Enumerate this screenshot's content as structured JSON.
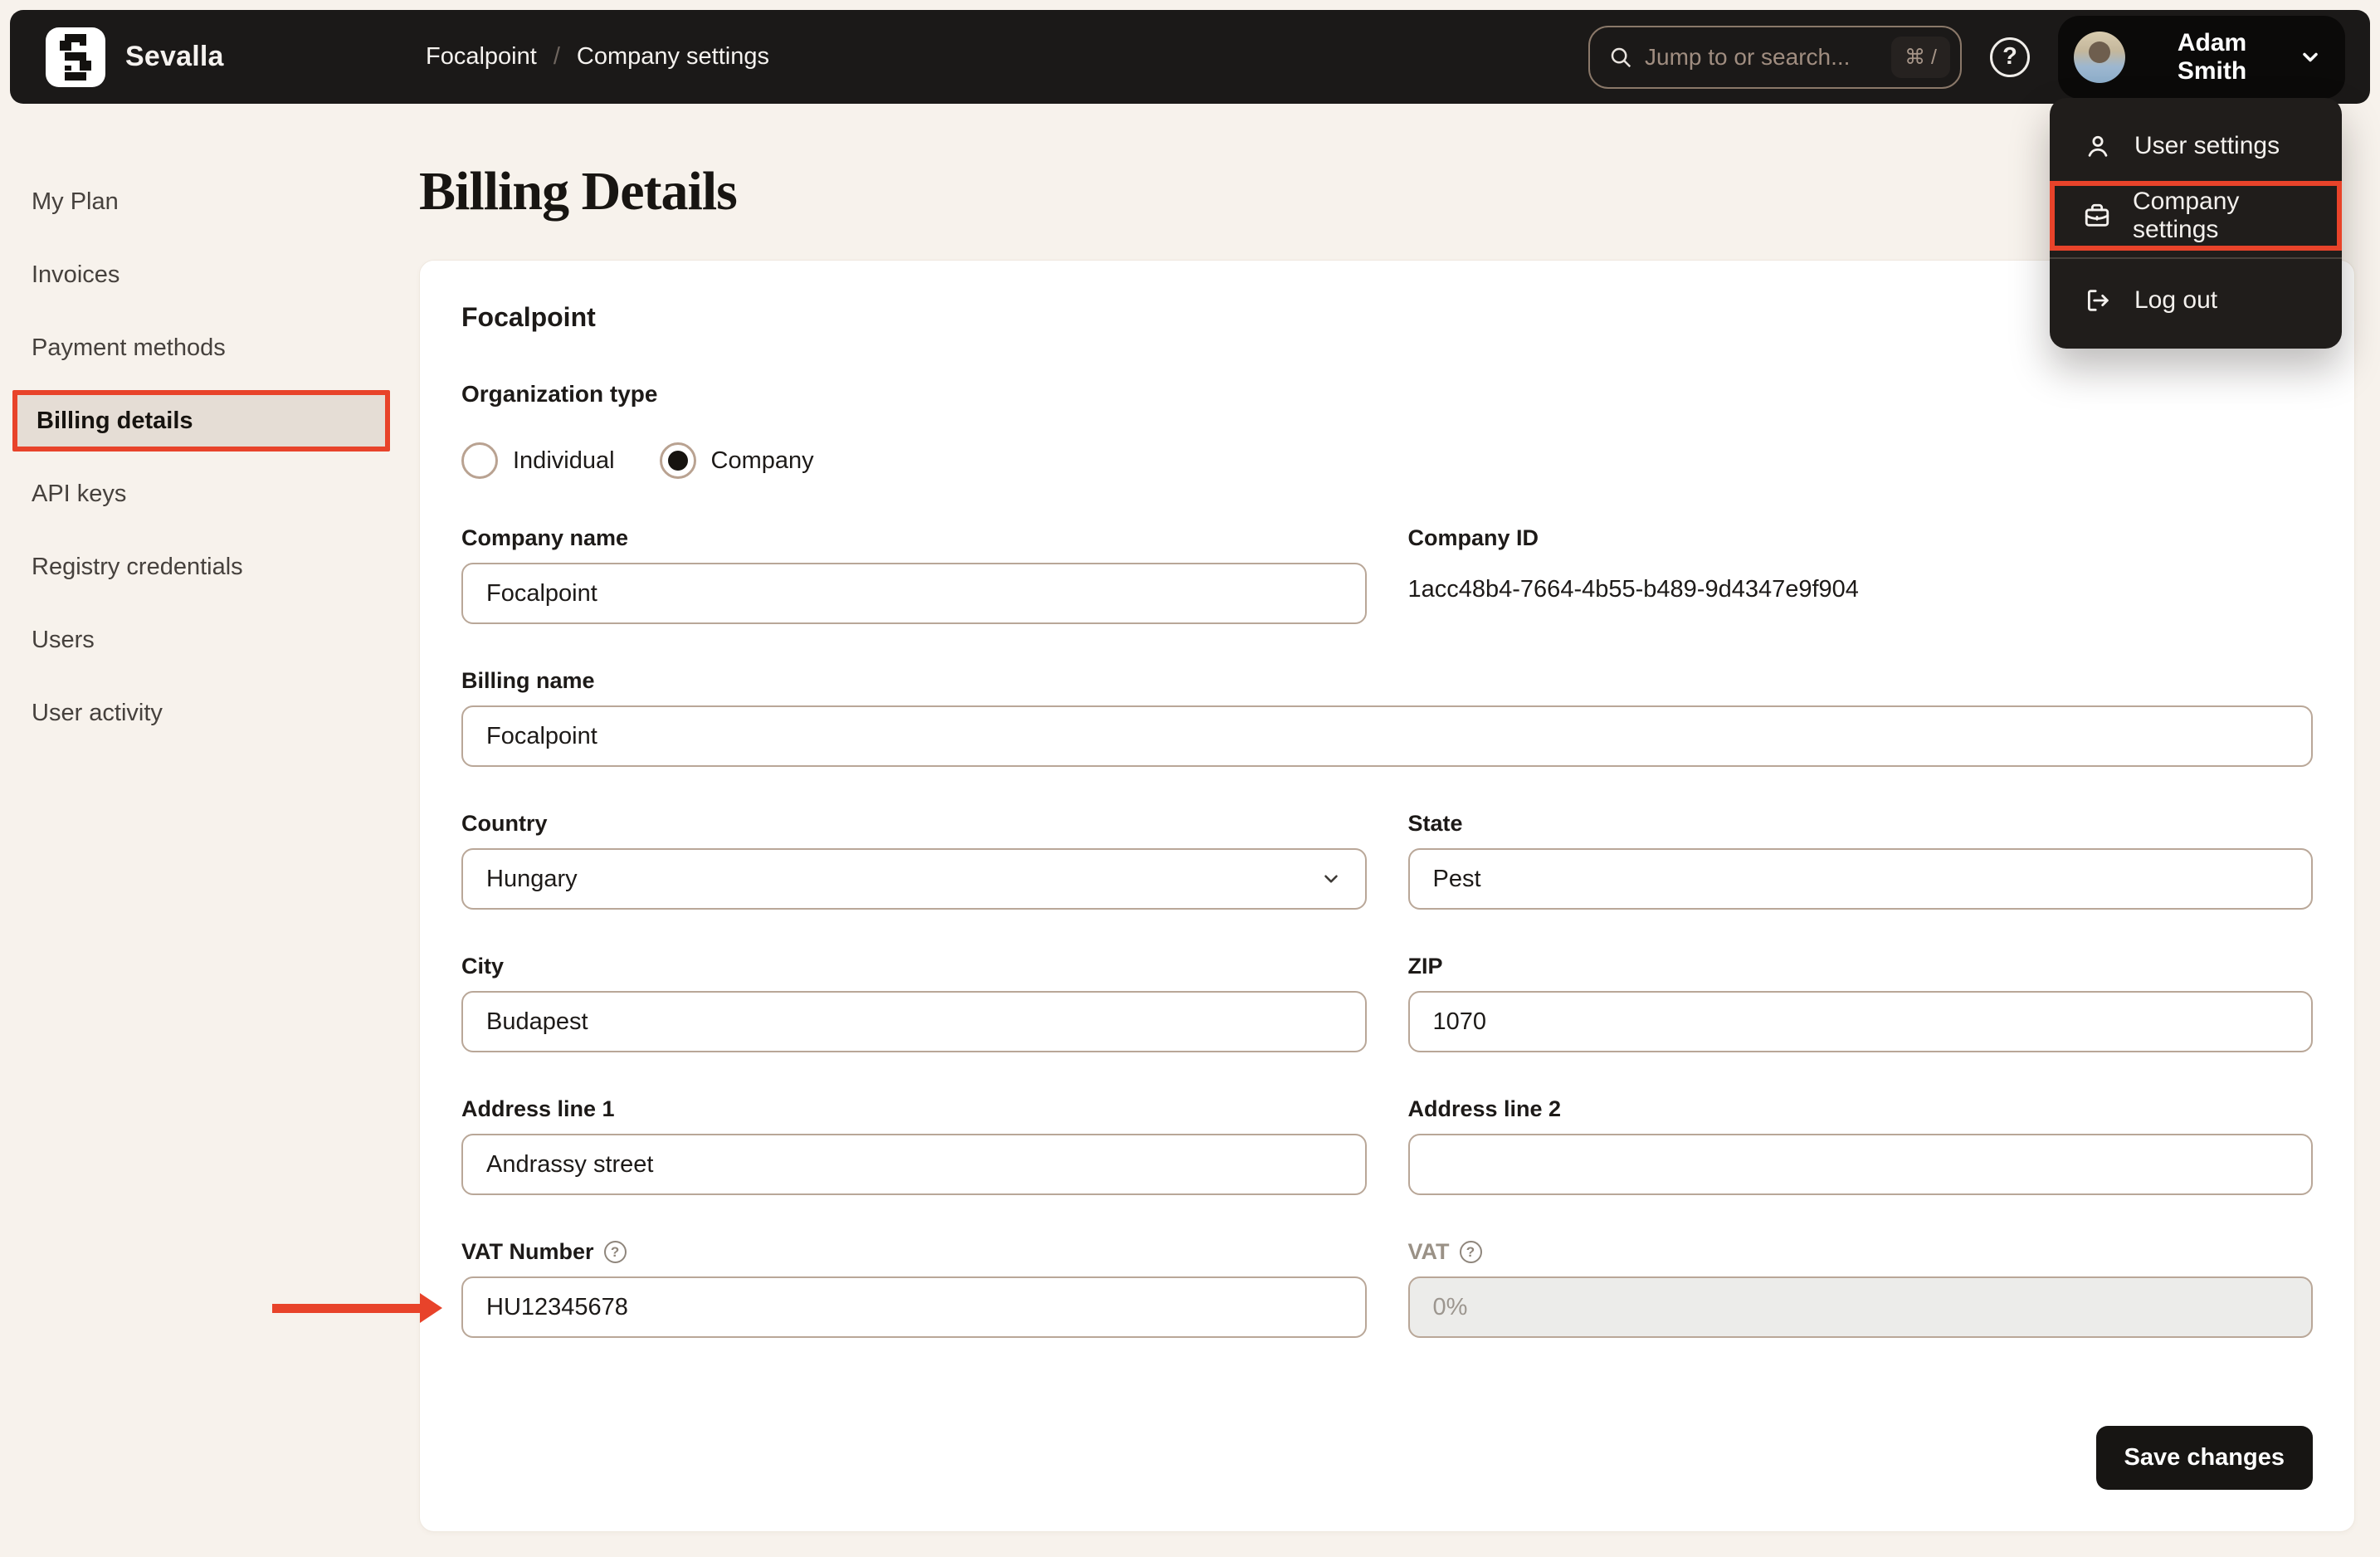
{
  "colors": {
    "annotation_red": "#e8432a",
    "topbar_bg": "#1b1918",
    "page_bg": "#f7f2ec",
    "active_item_bg": "#e5ddd5",
    "save_button_bg": "#171513"
  },
  "topbar": {
    "brand": {
      "name": "Sevalla",
      "logo_icon": "sevalla-logo"
    },
    "breadcrumb": {
      "project": "Focalpoint",
      "separator": "/",
      "page": "Company settings"
    },
    "search": {
      "icon": "search-icon",
      "placeholder": "Jump to or search...",
      "shortcut": "⌘ /"
    },
    "help_icon": "help-icon",
    "user": {
      "name": "Adam Smith",
      "avatar_icon": "avatar",
      "chevron_icon": "chevron-down-icon"
    }
  },
  "user_menu": {
    "items": [
      {
        "label": "User settings",
        "icon": "user-icon"
      },
      {
        "label": "Company settings",
        "icon": "briefcase-icon",
        "highlighted": true
      },
      {
        "label": "Log out",
        "icon": "logout-icon"
      }
    ]
  },
  "sidebar": {
    "active_index": 3,
    "items": [
      {
        "label": "My Plan"
      },
      {
        "label": "Invoices"
      },
      {
        "label": "Payment methods"
      },
      {
        "label": "Billing details"
      },
      {
        "label": "API keys"
      },
      {
        "label": "Registry credentials"
      },
      {
        "label": "Users"
      },
      {
        "label": "User activity"
      }
    ]
  },
  "page": {
    "title": "Billing Details"
  },
  "form": {
    "company_title": "Focalpoint",
    "organization_type": {
      "label": "Organization type",
      "options": [
        {
          "label": "Individual",
          "selected": false
        },
        {
          "label": "Company",
          "selected": true
        }
      ]
    },
    "company_name": {
      "label": "Company name",
      "value": "Focalpoint"
    },
    "company_id": {
      "label": "Company ID",
      "value": "1acc48b4-7664-4b55-b489-9d4347e9f904"
    },
    "billing_name": {
      "label": "Billing name",
      "value": "Focalpoint"
    },
    "country": {
      "label": "Country",
      "value": "Hungary"
    },
    "state": {
      "label": "State",
      "value": "Pest"
    },
    "city": {
      "label": "City",
      "value": "Budapest"
    },
    "zip": {
      "label": "ZIP",
      "value": "1070"
    },
    "address1": {
      "label": "Address line 1",
      "value": "Andrassy street"
    },
    "address2": {
      "label": "Address line 2",
      "value": ""
    },
    "vat_number": {
      "label": "VAT Number",
      "value": "HU12345678",
      "help_icon": "help-icon"
    },
    "vat": {
      "label": "VAT",
      "value": "0%",
      "disabled": true,
      "help_icon": "help-icon"
    },
    "save_label": "Save changes"
  }
}
